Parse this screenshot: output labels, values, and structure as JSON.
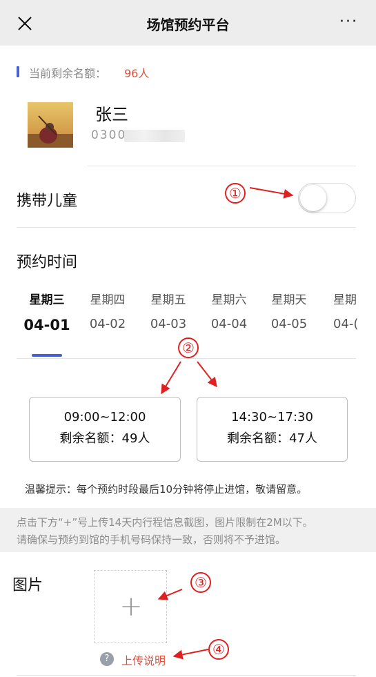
{
  "header": {
    "title": "场馆预约平台",
    "close_icon": "close-icon",
    "more_icon": "more-icon",
    "more_label": "···"
  },
  "quota": {
    "label": "当前剩余名额：",
    "value": "96人",
    "accent_color": "#4a5fd1",
    "value_color": "#e0503c"
  },
  "user": {
    "name": "张三",
    "phone_visible": "0300"
  },
  "children": {
    "label": "携带儿童",
    "enabled": false
  },
  "booking": {
    "label": "预约时间",
    "tabs": [
      {
        "day": "星期三",
        "date": "04-01",
        "active": true
      },
      {
        "day": "星期四",
        "date": "04-02"
      },
      {
        "day": "星期五",
        "date": "04-03"
      },
      {
        "day": "星期六",
        "date": "04-04"
      },
      {
        "day": "星期天",
        "date": "04-05"
      },
      {
        "day": "星期",
        "date": "04-("
      }
    ],
    "slots": [
      {
        "time": "09:00~12:00",
        "quota": "剩余名额：49人"
      },
      {
        "time": "14:30~17:30",
        "quota": "剩余名额：47人"
      }
    ]
  },
  "tip": "温馨提示：每个预约时段最后10分钟将停止进馆，敬请留意。",
  "notice": {
    "line1": "点击下方“+”号上传14天内行程信息截图，图片限制在2M以下。",
    "line2": "请确保与预约到馆的手机号码保持一致，否则将不予进馆。"
  },
  "upload": {
    "label": "图片",
    "plus": "+",
    "help_icon": "question-icon",
    "help_symbol": "?",
    "help_text": "上传说明",
    "help_color": "#e0503c"
  },
  "annotations": [
    "①",
    "②",
    "③",
    "④"
  ]
}
